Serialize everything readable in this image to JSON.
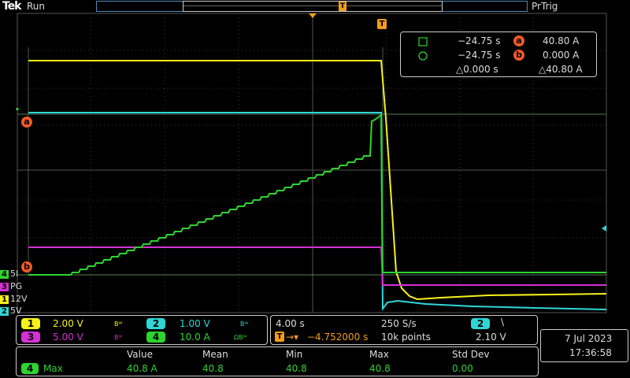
{
  "header": {
    "logo": "Tek",
    "status": "Run",
    "trigger_status": "PrTrig",
    "trigger_marker": "T"
  },
  "colors": {
    "ch1": "#f7f11a",
    "ch2": "#2fd6d6",
    "ch3": "#d530d5",
    "ch4": "#2ed42e",
    "cursor": "#f05a28",
    "trigger": "#f39b1d"
  },
  "cursor_readout": {
    "row1": {
      "time": "−24.75 s",
      "badge": "a",
      "value": "40.80 A"
    },
    "row2": {
      "time": "−24.75 s",
      "badge": "b",
      "value": "0.000 A"
    },
    "delta": {
      "time": "△0.000 s",
      "value": "△40.80 A"
    }
  },
  "screen_markers": {
    "cursor_a": "a",
    "cursor_b": "b",
    "trigger": "T"
  },
  "channel_labels": [
    {
      "num": "4",
      "name": "5I",
      "color": "#2ed42e"
    },
    {
      "num": "3",
      "name": "PG",
      "color": "#d530d5"
    },
    {
      "num": "1",
      "name": "12V",
      "color": "#f7f11a"
    },
    {
      "num": "2",
      "name": "5V",
      "color": "#2fd6d6"
    }
  ],
  "vertical": {
    "ch1": {
      "num": "1",
      "scale": "2.00 V",
      "bw": "Bᵂ"
    },
    "ch2": {
      "num": "2",
      "scale": "1.00 V",
      "bw": "Bᵂ"
    },
    "ch3": {
      "num": "3",
      "scale": "5.00 V",
      "bw": "Bᵂ"
    },
    "ch4": {
      "num": "4",
      "scale": "10.0 A",
      "bw": "ΩBᵂ"
    }
  },
  "horizontal": {
    "timebase": "4.00 s",
    "sample_rate": "250 S/s",
    "trigger_pos": "−4.752000 s",
    "record_length": "10k points",
    "trigger_source": "2",
    "trigger_slope": "\\",
    "trigger_level": "2.10 V"
  },
  "datetime": {
    "date": "7 Jul  2023",
    "time": "17:36:58"
  },
  "measurement": {
    "headers": [
      "Value",
      "Mean",
      "Min",
      "Max",
      "Std Dev"
    ],
    "source": "4",
    "label": "Max",
    "values": [
      "40.8 A",
      "40.8",
      "40.8",
      "40.8",
      "0.00"
    ]
  }
}
